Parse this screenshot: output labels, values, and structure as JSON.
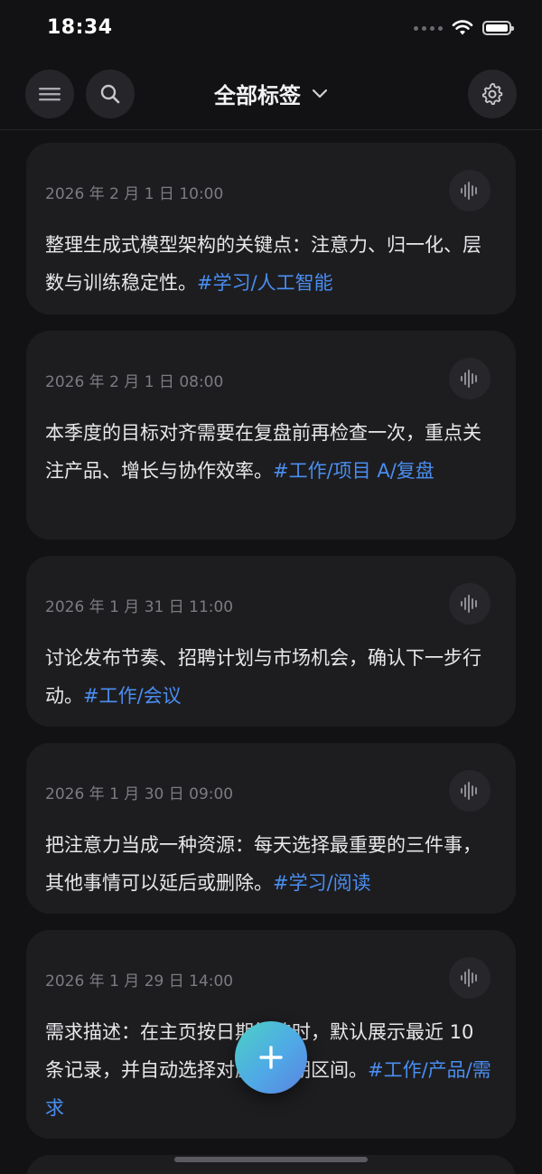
{
  "status": {
    "time": "18:34"
  },
  "header": {
    "title": "全部标签"
  },
  "notes": [
    {
      "time": "2026 年 2 月 1 日 10:00",
      "text": "整理生成式模型架构的关键点：注意力、归一化、层数与训练稳定性。",
      "tag": "#学习/人工智能"
    },
    {
      "time": "2026 年 2 月 1 日 08:00",
      "text": "本季度的目标对齐需要在复盘前再检查一次，重点关注产品、增长与协作效率。",
      "tag": "#工作/项目 A/复盘"
    },
    {
      "time": "2026 年 1 月 31 日 11:00",
      "text": "讨论发布节奏、招聘计划与市场机会，确认下一步行动。",
      "tag": "#工作/会议"
    },
    {
      "time": "2026 年 1 月 30 日 09:00",
      "text": "把注意力当成一种资源：每天选择最重要的三件事，其他事情可以延后或删除。",
      "tag": "#学习/阅读"
    },
    {
      "time": "2026 年 1 月 29 日 14:00",
      "text": "需求描述：在主页按日期筛选时，默认展示最近 10 条记录，并自动选择对应的日期区间。",
      "tag": "#工作/产品/需求"
    }
  ],
  "colors": {
    "accent_tag": "#4a8ef0",
    "card_bg": "#1d1d20",
    "background": "#121214"
  }
}
